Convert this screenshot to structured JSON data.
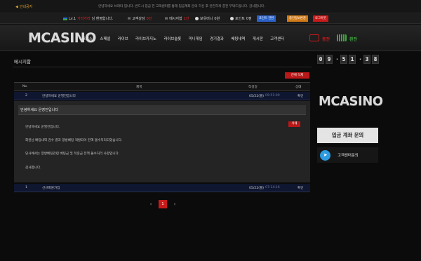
{
  "notice": {
    "label": "안내공지",
    "text": "안녕하세요 브라타 입니다. 반드시 입금 전 고객센터를 통해 입금계좌 문의 하신 후 안전하게 충전 부탁드립니다. 감사합니다."
  },
  "user_bar": {
    "level": "Lv.1",
    "nickname": "가라가라",
    "greeting": "님 환영합니다.",
    "consult_label": "고객상담",
    "consult_count": "0건",
    "message_label": "메시지함",
    "message_count": "1건",
    "money_label": "보유머니",
    "money_value": "0원",
    "point_label": "포인트",
    "point_value": "0점",
    "btn_point_convert": "포인트 전환",
    "btn_charge_history": "충전정보변경",
    "btn_logout": "로그아웃"
  },
  "header": {
    "logo": "MCASINO",
    "nav": [
      "크로스",
      "스페셜",
      "라이브",
      "라이브카지노",
      "라이브슬롯",
      "미니게임",
      "경기결과",
      "배팅내역",
      "게시판",
      "고객센터"
    ],
    "charge_label": "충전",
    "exchange_label": "환전"
  },
  "section": {
    "title": "메시지함",
    "delete_all": "전체 삭제"
  },
  "table": {
    "headers": {
      "no": "No.",
      "title": "제목",
      "date": "작성일",
      "status": "상태"
    },
    "rows": [
      {
        "no": "2",
        "title": "안녕하세요 운영진입니다",
        "date": "05/22(월)",
        "time": "09:51:09",
        "status": "확인"
      },
      {
        "no": "1",
        "title": "신규회원가입",
        "date": "05/22(월)",
        "time": "07:14:16",
        "status": "확인"
      }
    ]
  },
  "message": {
    "title": "안녕하세요 운영진입니다",
    "delete_label": "삭제",
    "lines": [
      "안녕하세요 운영진입니다.",
      "회원님 배팅내역 검수 결과 양방베팅 적발되어 전액 몰수처리되었습니다.",
      "당사에서는 양방베팅관련 베팅금 및 적중금 전액 몰수처리 사항입니다.",
      "감사합니다."
    ]
  },
  "pagination": {
    "prev": "‹",
    "current": "1",
    "next": "›"
  },
  "side": {
    "clock": {
      "h": [
        "0",
        "9"
      ],
      "m": [
        "5",
        "1"
      ],
      "s": [
        "3",
        "8"
      ]
    },
    "logo": "MCASINO",
    "deposit_inquiry": "입금 계좌 문의",
    "support_label": "고객센터문의"
  },
  "colors": {
    "accent_red": "#c71a1a",
    "row_bg": "#0e1630",
    "charge_green": "#3fa43f",
    "telegram_blue": "#2c9be0"
  }
}
